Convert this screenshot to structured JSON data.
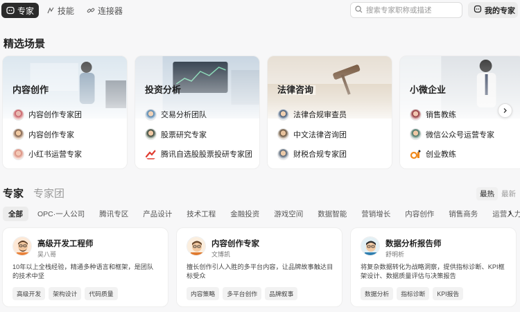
{
  "nav": {
    "experts_label": "专家",
    "skills_label": "技能",
    "connectors_label": "连接器"
  },
  "search": {
    "placeholder": "搜索专家职称或描述"
  },
  "my_experts_label": "我的专家",
  "featured": {
    "title": "精选场景",
    "cards": [
      {
        "title": "内容创作",
        "items": [
          "内容创作专家团",
          "内容创作专家",
          "小红书运营专家"
        ]
      },
      {
        "title": "投资分析",
        "items": [
          "交易分析团队",
          "股票研究专家",
          "腾讯自选股股票投研专家团"
        ]
      },
      {
        "title": "法律咨询",
        "items": [
          "法律合规审查员",
          "中文法律咨询团",
          "财税合规专家团"
        ]
      },
      {
        "title": "小微企业",
        "items": [
          "销售教练",
          "微信公众号运营专家",
          "创业教练"
        ]
      }
    ]
  },
  "experts_section": {
    "tab_experts": "专家",
    "tab_teams": "专家团",
    "sort_hot": "最热",
    "sort_new": "最新",
    "categories": [
      "全部",
      "OPC·一人公司",
      "腾讯专区",
      "产品设计",
      "技术工程",
      "金融投资",
      "游戏空间",
      "数据智能",
      "营销增长",
      "内容创作",
      "销售商务",
      "运营人力"
    ],
    "cards": [
      {
        "name": "高级开发工程师",
        "author": "吴八哥",
        "desc": "10年以上全栈经验，精通多种语言和框架，是团队的技术中坚",
        "tags": [
          "高级开发",
          "架构设计",
          "代码质量"
        ]
      },
      {
        "name": "内容创作专家",
        "author": "文博凯",
        "desc": "擅长创作引人入胜的多平台内容，让品牌故事触达目标受众",
        "tags": [
          "内容策略",
          "多平台创作",
          "品牌叙事"
        ]
      },
      {
        "name": "数据分析报告师",
        "author": "舒明析",
        "desc": "将复杂数据转化为战略洞察，提供指标诊断、KPI框架设计、数据质量评估与决策报告",
        "tags": [
          "数据分析",
          "指标诊断",
          "KPI报告"
        ]
      }
    ]
  },
  "colors": {
    "active_nav": "#2b2b2b",
    "accent_red": "#e03c31"
  },
  "icons": [
    "experts-icon",
    "skills-icon",
    "connector-icon",
    "search-icon",
    "my-experts-icon",
    "chevron-right-icon"
  ]
}
